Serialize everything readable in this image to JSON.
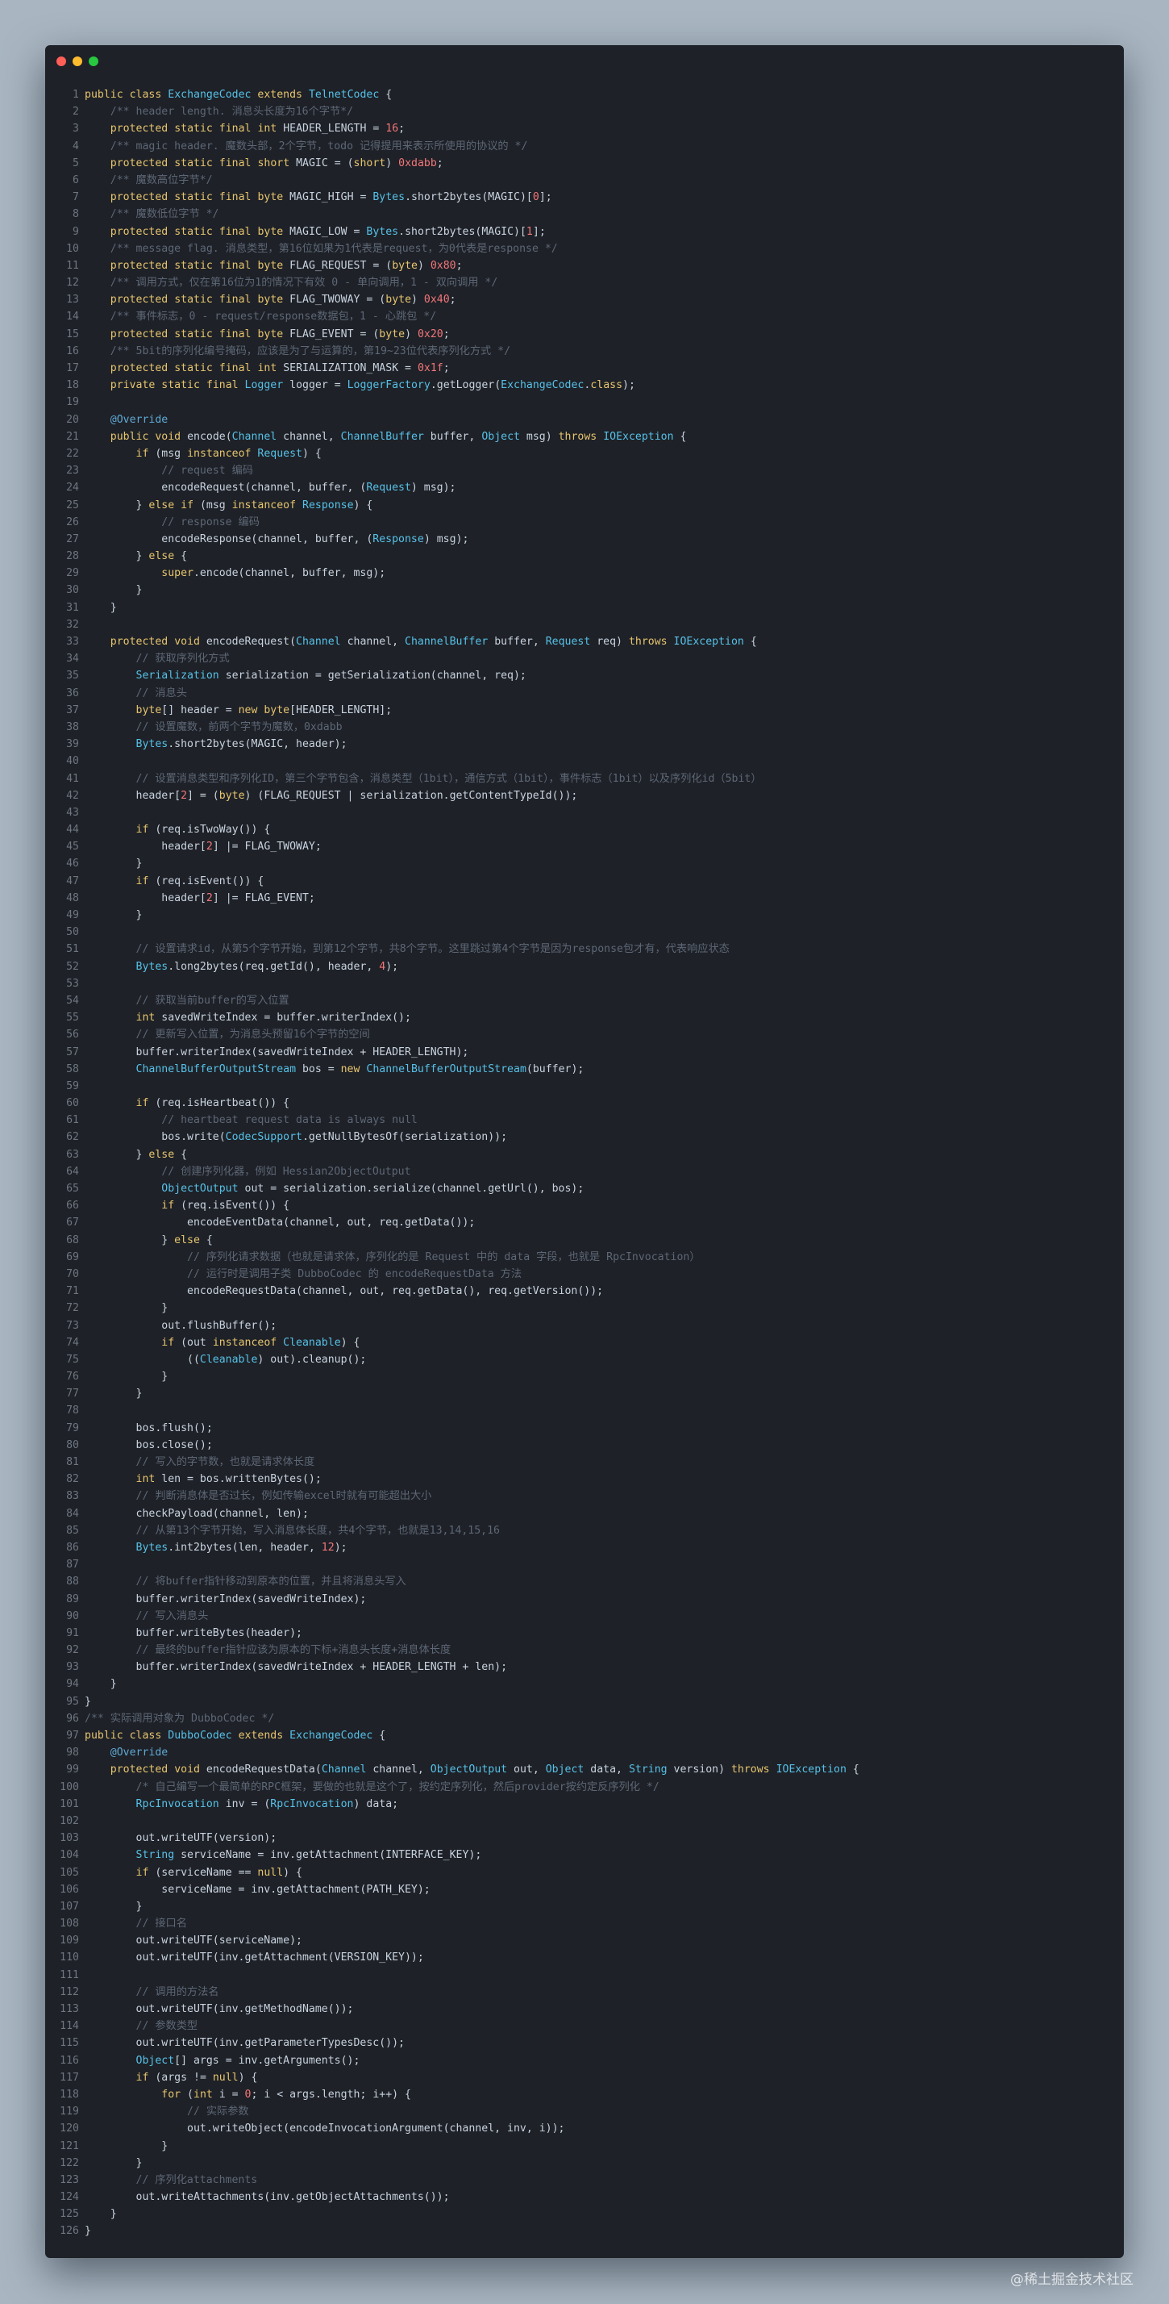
{
  "window": {
    "buttons": [
      "close",
      "minimize",
      "maximize"
    ],
    "colors": {
      "close": "#fe5f57",
      "minimize": "#febc2e",
      "maximize": "#28c840"
    }
  },
  "watermark": "@稀土掘金技术社区",
  "code": {
    "lines": [
      "public class ExchangeCodec extends TelnetCodec {",
      "    /** header length. 消息头长度为16个字节*/",
      "    protected static final int HEADER_LENGTH = 16;",
      "    /** magic header. 魔数头部，2个字节，todo 记得提用来表示所使用的协议的 */",
      "    protected static final short MAGIC = (short) 0xdabb;",
      "    /** 魔数高位字节*/",
      "    protected static final byte MAGIC_HIGH = Bytes.short2bytes(MAGIC)[0];",
      "    /** 魔数低位字节 */",
      "    protected static final byte MAGIC_LOW = Bytes.short2bytes(MAGIC)[1];",
      "    /** message flag. 消息类型，第16位如果为1代表是request，为0代表是response */",
      "    protected static final byte FLAG_REQUEST = (byte) 0x80;",
      "    /** 调用方式，仅在第16位为1的情况下有效 0 - 单向调用，1 - 双向调用 */",
      "    protected static final byte FLAG_TWOWAY = (byte) 0x40;",
      "    /** 事件标志，0 - request/response数据包，1 - 心跳包 */",
      "    protected static final byte FLAG_EVENT = (byte) 0x20;",
      "    /** 5bit的序列化编号掩码，应该是为了与运算的，第19~23位代表序列化方式 */",
      "    protected static final int SERIALIZATION_MASK = 0x1f;",
      "    private static final Logger logger = LoggerFactory.getLogger(ExchangeCodec.class);",
      "",
      "    @Override",
      "    public void encode(Channel channel, ChannelBuffer buffer, Object msg) throws IOException {",
      "        if (msg instanceof Request) {",
      "            // request 编码",
      "            encodeRequest(channel, buffer, (Request) msg);",
      "        } else if (msg instanceof Response) {",
      "            // response 编码",
      "            encodeResponse(channel, buffer, (Response) msg);",
      "        } else {",
      "            super.encode(channel, buffer, msg);",
      "        }",
      "    }",
      "",
      "    protected void encodeRequest(Channel channel, ChannelBuffer buffer, Request req) throws IOException {",
      "        // 获取序列化方式",
      "        Serialization serialization = getSerialization(channel, req);",
      "        // 消息头",
      "        byte[] header = new byte[HEADER_LENGTH];",
      "        // 设置魔数，前两个字节为魔数，0xdabb",
      "        Bytes.short2bytes(MAGIC, header);",
      "",
      "        // 设置消息类型和序列化ID，第三个字节包含，消息类型（1bit），通信方式（1bit），事件标志（1bit）以及序列化id（5bit）",
      "        header[2] = (byte) (FLAG_REQUEST | serialization.getContentTypeId());",
      "",
      "        if (req.isTwoWay()) {",
      "            header[2] |= FLAG_TWOWAY;",
      "        }",
      "        if (req.isEvent()) {",
      "            header[2] |= FLAG_EVENT;",
      "        }",
      "",
      "        // 设置请求id，从第5个字节开始，到第12个字节，共8个字节。这里跳过第4个字节是因为response包才有，代表响应状态",
      "        Bytes.long2bytes(req.getId(), header, 4);",
      "",
      "        // 获取当前buffer的写入位置",
      "        int savedWriteIndex = buffer.writerIndex();",
      "        // 更新写入位置，为消息头预留16个字节的空间",
      "        buffer.writerIndex(savedWriteIndex + HEADER_LENGTH);",
      "        ChannelBufferOutputStream bos = new ChannelBufferOutputStream(buffer);",
      "",
      "        if (req.isHeartbeat()) {",
      "            // heartbeat request data is always null",
      "            bos.write(CodecSupport.getNullBytesOf(serialization));",
      "        } else {",
      "            // 创建序列化器，例如 Hessian2ObjectOutput",
      "            ObjectOutput out = serialization.serialize(channel.getUrl(), bos);",
      "            if (req.isEvent()) {",
      "                encodeEventData(channel, out, req.getData());",
      "            } else {",
      "                // 序列化请求数据（也就是请求体，序列化的是 Request 中的 data 字段，也就是 RpcInvocation）",
      "                // 运行时是调用子类 DubboCodec 的 encodeRequestData 方法",
      "                encodeRequestData(channel, out, req.getData(), req.getVersion());",
      "            }",
      "            out.flushBuffer();",
      "            if (out instanceof Cleanable) {",
      "                ((Cleanable) out).cleanup();",
      "            }",
      "        }",
      "",
      "        bos.flush();",
      "        bos.close();",
      "        // 写入的字节数，也就是请求体长度",
      "        int len = bos.writtenBytes();",
      "        // 判断消息体是否过长，例如传输excel时就有可能超出大小",
      "        checkPayload(channel, len);",
      "        // 从第13个字节开始，写入消息体长度，共4个字节，也就是13,14,15,16",
      "        Bytes.int2bytes(len, header, 12);",
      "",
      "        // 将buffer指针移动到原本的位置，并且将消息头写入",
      "        buffer.writerIndex(savedWriteIndex);",
      "        // 写入消息头",
      "        buffer.writeBytes(header);",
      "        // 最终的buffer指针应该为原本的下标+消息头长度+消息体长度",
      "        buffer.writerIndex(savedWriteIndex + HEADER_LENGTH + len);",
      "    }",
      "}",
      "/** 实际调用对象为 DubboCodec */",
      "public class DubboCodec extends ExchangeCodec {",
      "    @Override",
      "    protected void encodeRequestData(Channel channel, ObjectOutput out, Object data, String version) throws IOException {",
      "        /* 自己编写一个最简单的RPC框架，要做的也就是这个了，按约定序列化，然后provider按约定反序列化 */",
      "        RpcInvocation inv = (RpcInvocation) data;",
      "",
      "        out.writeUTF(version);",
      "        String serviceName = inv.getAttachment(INTERFACE_KEY);",
      "        if (serviceName == null) {",
      "            serviceName = inv.getAttachment(PATH_KEY);",
      "        }",
      "        // 接口名",
      "        out.writeUTF(serviceName);",
      "        out.writeUTF(inv.getAttachment(VERSION_KEY));",
      "",
      "        // 调用的方法名",
      "        out.writeUTF(inv.getMethodName());",
      "        // 参数类型",
      "        out.writeUTF(inv.getParameterTypesDesc());",
      "        Object[] args = inv.getArguments();",
      "        if (args != null) {",
      "            for (int i = 0; i < args.length; i++) {",
      "                // 实际参数",
      "                out.writeObject(encodeInvocationArgument(channel, inv, i));",
      "            }",
      "        }",
      "        // 序列化attachments",
      "        out.writeAttachments(inv.getObjectAttachments());",
      "    }",
      "}"
    ]
  }
}
